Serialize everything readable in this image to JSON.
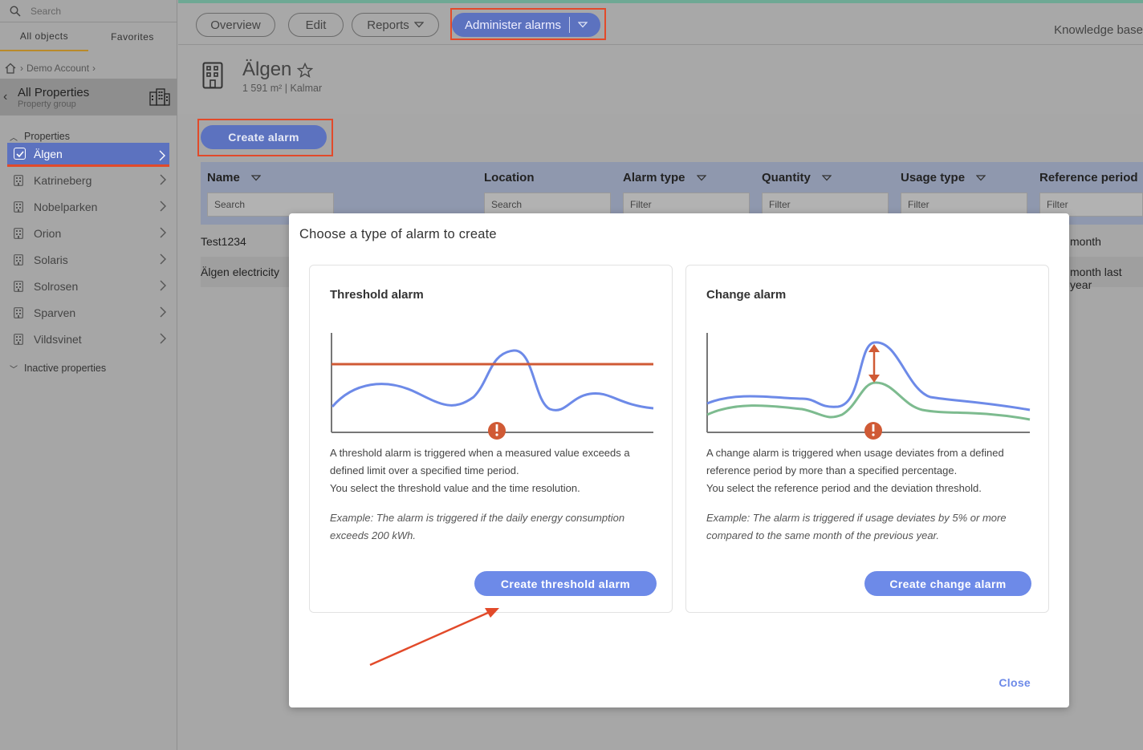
{
  "sidebar": {
    "search_placeholder": "Search",
    "tabs": [
      "All objects",
      "Favorites"
    ],
    "breadcrumb": "Demo Account",
    "group": {
      "title": "All Properties",
      "subtitle": "Property group"
    },
    "properties_label": "Properties",
    "items": [
      {
        "label": "Älgen",
        "selected": true
      },
      {
        "label": "Katrineberg"
      },
      {
        "label": "Nobelparken"
      },
      {
        "label": "Orion"
      },
      {
        "label": "Solaris"
      },
      {
        "label": "Solrosen"
      },
      {
        "label": "Sparven"
      },
      {
        "label": "Vildsvinet"
      }
    ],
    "inactive_label": "Inactive properties"
  },
  "topbar": {
    "overview": "Overview",
    "edit": "Edit",
    "reports": "Reports",
    "administer_alarms": "Administer alarms",
    "knowledge_base": "Knowledge base"
  },
  "property": {
    "name": "Älgen",
    "area": "1 591 m²",
    "city": "Kalmar",
    "subtitle": "1 591 m² | Kalmar"
  },
  "toolbar": {
    "create_alarm": "Create alarm"
  },
  "table": {
    "columns": [
      "Name",
      "Location",
      "Alarm type",
      "Quantity",
      "Usage type",
      "Reference period"
    ],
    "filters": {
      "name": "Search",
      "location": "Search",
      "alarm_type": "Filter",
      "quantity": "Filter",
      "usage_type": "Filter",
      "reference_period": "Filter"
    },
    "rows": [
      {
        "name": "Test1234",
        "reference_period": "month"
      },
      {
        "name": "Älgen electricity",
        "reference_period": "month last year"
      }
    ]
  },
  "modal": {
    "title": "Choose a type of alarm to create",
    "threshold": {
      "title": "Threshold alarm",
      "desc1": "A threshold alarm is triggered when a measured value exceeds a defined limit over a specified time period.",
      "desc2": "You select the threshold value and the time resolution.",
      "example": "Example: The alarm is triggered if the daily energy consumption exceeds 200 kWh.",
      "button": "Create threshold alarm"
    },
    "change": {
      "title": "Change alarm",
      "desc1": "A change alarm is triggered when usage deviates from a defined reference period by more than a specified percentage.",
      "desc2": "You select the reference period and the deviation threshold.",
      "example": "Example: The alarm is triggered if usage deviates by 5% or more compared to the same month of the previous year.",
      "button": "Create change alarm"
    },
    "close": "Close"
  },
  "colors": {
    "brand": "#5c72bf",
    "button": "#6d8ae8",
    "highlight": "#e24a2a",
    "series_blue": "#6d8ae8",
    "series_green": "#7dbb8f",
    "threshold_line": "#d05a35"
  }
}
